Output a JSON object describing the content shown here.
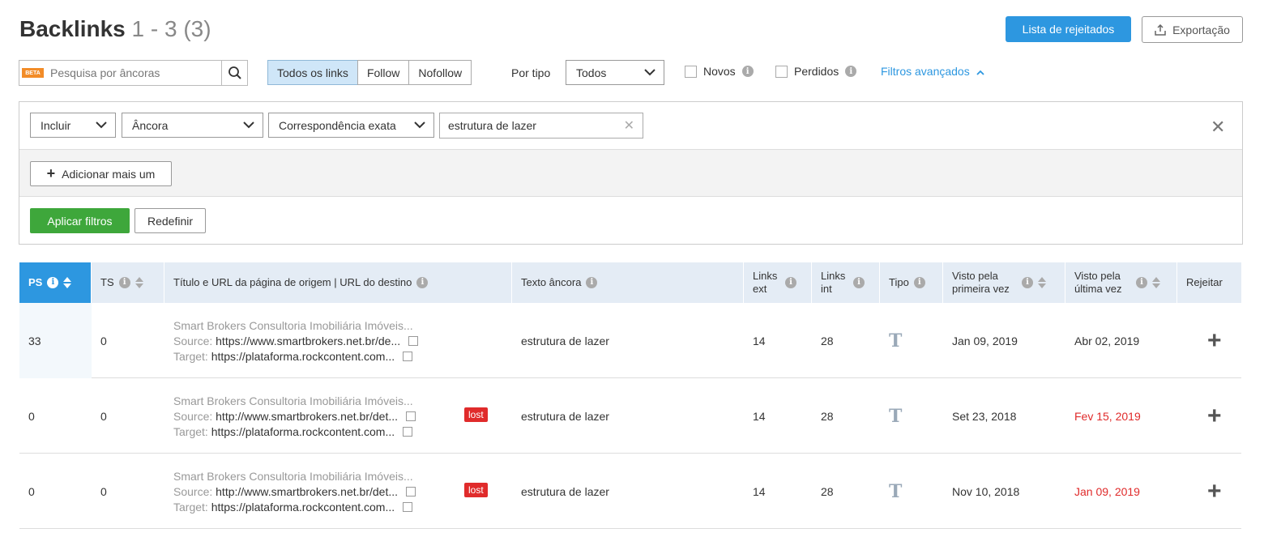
{
  "header": {
    "title": "Backlinks",
    "count": " 1 - 3 (3)"
  },
  "actions": {
    "rejected_list": "Lista de rejeitados",
    "export": "Exportação"
  },
  "search": {
    "badge": "BETA",
    "placeholder": "Pesquisa por âncoras"
  },
  "link_filter": {
    "options": [
      "Todos os links",
      "Follow",
      "Nofollow"
    ],
    "active": "Todos os links"
  },
  "type_filter": {
    "label": "Por tipo",
    "value": "Todos"
  },
  "checks": {
    "new": "Novos",
    "lost": "Perdidos"
  },
  "advanced": "Filtros avançados",
  "filter_panel": {
    "include": "Incluir",
    "field": "Âncora",
    "match": "Correspondência exata",
    "value": "estrutura de lazer",
    "add_more": "Adicionar mais um",
    "apply": "Aplicar filtros",
    "reset": "Redefinir"
  },
  "columns": {
    "ps": "PS",
    "ts": "TS",
    "source": "Título e URL da página de origem | URL do destino",
    "anchor": "Texto âncora",
    "links_ext": "Links ext",
    "links_int": "Links int",
    "type": "Tipo",
    "first_seen": "Visto pela primeira vez",
    "last_seen": "Visto pela última vez",
    "reject": "Rejeitar"
  },
  "rows": [
    {
      "ps": "33",
      "ts": "0",
      "title": "Smart Brokers Consultoria Imobiliária  Imóveis...",
      "source_label": "Source:",
      "source": "https://www.smartbrokers.net.br/de...",
      "target_label": "Target:",
      "target": "https://plataforma.rockcontent.com...",
      "lost": "",
      "anchor": "estrutura de lazer",
      "ext": "14",
      "int": "28",
      "type": "T",
      "first": "Jan 09, 2019",
      "last": "Abr 02, 2019",
      "last_red": false
    },
    {
      "ps": "0",
      "ts": "0",
      "title": "Smart Brokers Consultoria Imobiliária  Imóveis...",
      "source_label": "Source:",
      "source": "http://www.smartbrokers.net.br/det...",
      "target_label": "Target:",
      "target": "https://plataforma.rockcontent.com...",
      "lost": "lost",
      "anchor": "estrutura de lazer",
      "ext": "14",
      "int": "28",
      "type": "T",
      "first": "Set 23, 2018",
      "last": "Fev 15, 2019",
      "last_red": true
    },
    {
      "ps": "0",
      "ts": "0",
      "title": "Smart Brokers Consultoria Imobiliária  Imóveis...",
      "source_label": "Source:",
      "source": "http://www.smartbrokers.net.br/det...",
      "target_label": "Target:",
      "target": "https://plataforma.rockcontent.com...",
      "lost": "lost",
      "anchor": "estrutura de lazer",
      "ext": "14",
      "int": "28",
      "type": "T",
      "first": "Nov 10, 2018",
      "last": "Jan 09, 2019",
      "last_red": true
    }
  ]
}
